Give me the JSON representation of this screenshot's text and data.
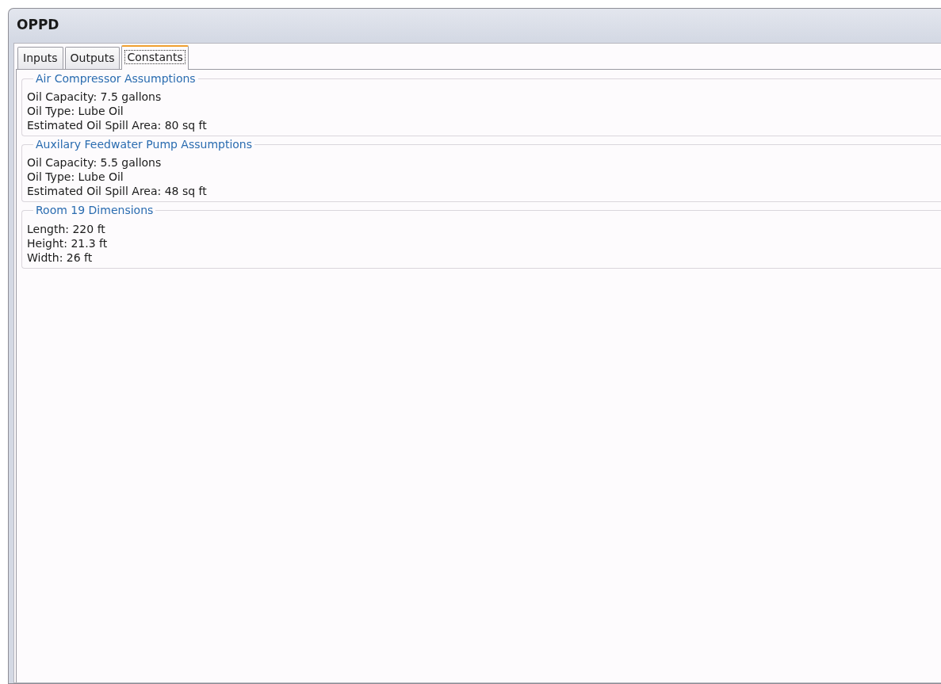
{
  "window": {
    "title": "OPPD"
  },
  "tabs": [
    {
      "label": "Inputs",
      "selected": false
    },
    {
      "label": "Outputs",
      "selected": false
    },
    {
      "label": "Constants",
      "selected": true
    }
  ],
  "groups": [
    {
      "title": "Air Compressor Assumptions",
      "lines": [
        "Oil Capacity: 7.5 gallons",
        "Oil Type: Lube Oil",
        "Estimated Oil Spill Area: 80 sq ft"
      ]
    },
    {
      "title": "Auxilary Feedwater Pump Assumptions",
      "lines": [
        "Oil Capacity: 5.5 gallons",
        "Oil Type: Lube Oil",
        "Estimated Oil Spill Area: 48 sq ft"
      ]
    },
    {
      "title": "Room 19 Dimensions",
      "lines": [
        "Length: 220 ft",
        "Height: 21.3 ft",
        "Width: 26 ft"
      ]
    }
  ]
}
